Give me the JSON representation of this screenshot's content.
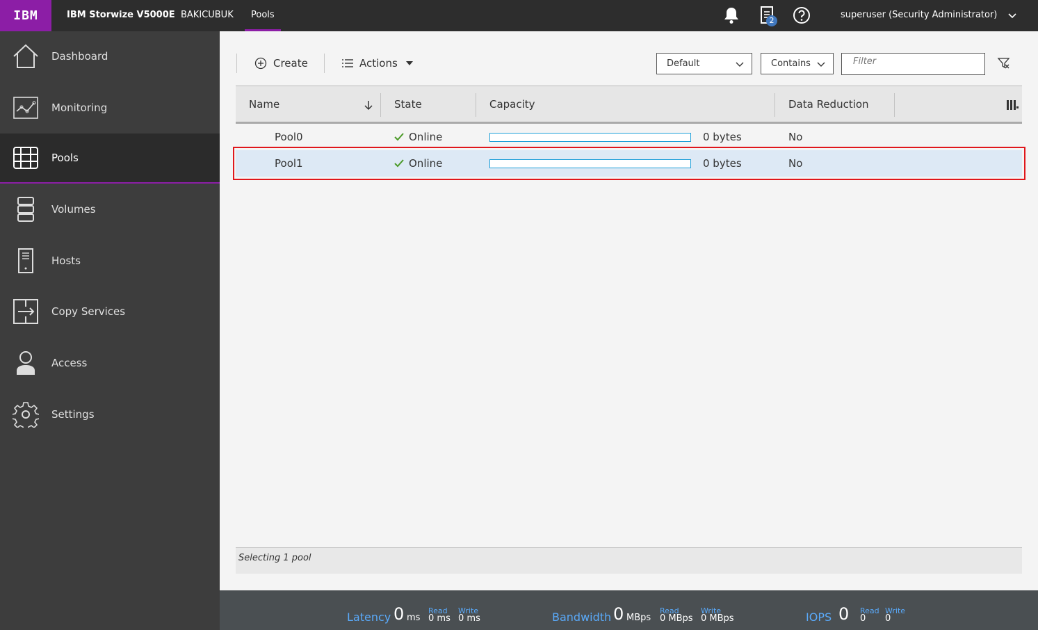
{
  "header": {
    "logo": "IBM",
    "product": "IBM Storwize V5000E",
    "system": "BAKICUBUK",
    "page": "Pools",
    "notifications_count": "2",
    "user": "superuser (Security Administrator)"
  },
  "sidebar": {
    "items": [
      {
        "label": "Dashboard",
        "icon": "home-icon"
      },
      {
        "label": "Monitoring",
        "icon": "monitoring-icon"
      },
      {
        "label": "Pools",
        "icon": "pools-icon",
        "active": true
      },
      {
        "label": "Volumes",
        "icon": "volumes-icon"
      },
      {
        "label": "Hosts",
        "icon": "hosts-icon"
      },
      {
        "label": "Copy Services",
        "icon": "copy-services-icon"
      },
      {
        "label": "Access",
        "icon": "access-icon"
      },
      {
        "label": "Settings",
        "icon": "settings-icon"
      }
    ]
  },
  "toolbar": {
    "create_label": "Create",
    "actions_label": "Actions",
    "view_select": "Default",
    "match_select": "Contains",
    "filter_placeholder": "Filter"
  },
  "table": {
    "columns": [
      "Name",
      "State",
      "Capacity",
      "Data Reduction"
    ],
    "rows": [
      {
        "name": "Pool0",
        "state": "Online",
        "capacity": "0 bytes",
        "capacity_used_fraction": 0,
        "data_reduction": "No",
        "selected": false
      },
      {
        "name": "Pool1",
        "state": "Online",
        "capacity": "0 bytes",
        "capacity_used_fraction": 0,
        "data_reduction": "No",
        "selected": true
      }
    ],
    "status": "Selecting 1 pool"
  },
  "performance": {
    "latency": {
      "label": "Latency",
      "value": "0",
      "unit": "ms",
      "read_label": "Read",
      "read": "0 ms",
      "write_label": "Write",
      "write": "0 ms"
    },
    "bandwidth": {
      "label": "Bandwidth",
      "value": "0",
      "unit": "MBps",
      "read_label": "Read",
      "read": "0 MBps",
      "write_label": "Write",
      "write": "0 MBps"
    },
    "iops": {
      "label": "IOPS",
      "value": "0",
      "read_label": "Read",
      "read": "0",
      "write_label": "Write",
      "write": "0"
    }
  },
  "colors": {
    "brand": "#8c1ea6",
    "accent_blue": "#5aaafa",
    "selected_row": "#dde9f5",
    "selection_outline": "#e0161b",
    "online_check": "#4b9a28"
  }
}
